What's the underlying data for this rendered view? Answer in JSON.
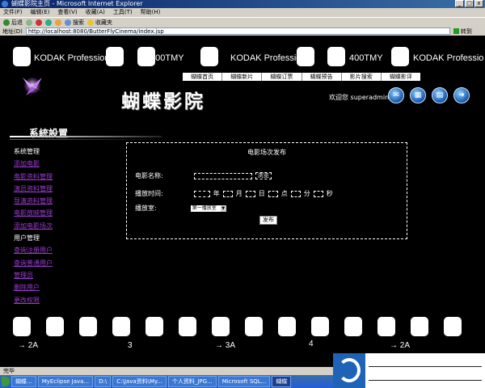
{
  "window": {
    "title": "蝴蝶影院主页 - Microsoft Internet Explorer"
  },
  "menubar": [
    "文件(F)",
    "编辑(E)",
    "查看(V)",
    "收藏(A)",
    "工具(T)",
    "帮助(H)"
  ],
  "toolbar": {
    "back": "后退",
    "search": "搜索",
    "favorites": "收藏夹"
  },
  "address": {
    "label": "地址(D)",
    "url": "http://localhost:8080/ButterFlyCinema/index.jsp",
    "go": "转到"
  },
  "film_strip": {
    "top_labels": [
      "KODAK Professional",
      "400TMY",
      "KODAK Professional",
      "400TMY",
      "KODAK Professio"
    ],
    "bottom_labels": [
      "→ 2A",
      "3",
      "→ 3A",
      "4",
      "→ 2A"
    ]
  },
  "nav": [
    "蝴蝶首页",
    "蝴蝶新片",
    "蝴蝶订票",
    "蝴蝶预告",
    "影片搜索",
    "蝴蝶影评"
  ],
  "logo": "蝴蝶影院",
  "welcome": "欢迎您  superadmin",
  "header_icons": [
    "mail-icon",
    "calendar-icon",
    "book-icon",
    "arrow-icon"
  ],
  "sidebar": {
    "title": "系統設置",
    "groups": [
      {
        "heading": "系统管理",
        "items": [
          "添加电影",
          "电影资料管理",
          "演员资料管理",
          "导演资料管理",
          "电影放映管理",
          "添加电影场次"
        ]
      },
      {
        "heading": "用户管理",
        "items": [
          "查询注册用户",
          "查询普通用户",
          "管理员",
          "删除用户",
          "更改权限"
        ]
      }
    ]
  },
  "form": {
    "title": "电影场次发布",
    "movie_label": "电影名称:",
    "browse_label": "浏览",
    "time_label": "播放时间:",
    "time_units": [
      "年",
      "月",
      "日",
      "点",
      "分",
      "秒"
    ],
    "room_label": "播放室:",
    "room_selected": "第一播放室",
    "submit_label": "发布"
  },
  "statusbar": {
    "text": "完毕"
  },
  "taskbar": [
    "蝴蝶...",
    "MyEclipse Java...",
    "D:\\",
    "C:\\Java资料\\My...",
    "个人资料_JPG...",
    "Microsoft SQL...",
    "蝴蝶"
  ]
}
